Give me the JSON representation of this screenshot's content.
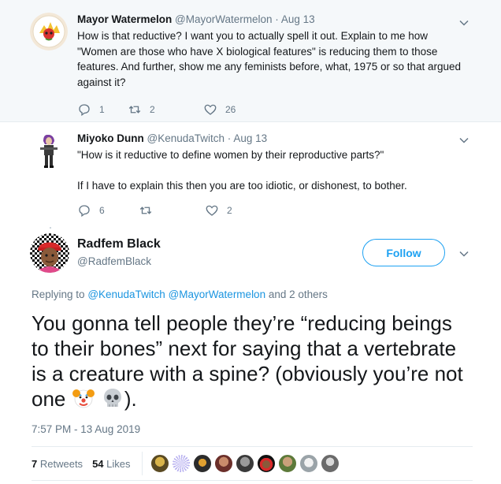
{
  "tweet1": {
    "name": "Mayor Watermelon",
    "handle": "@MayorWatermelon",
    "dot": "·",
    "date": "Aug 13",
    "paragraphs": [
      "How is that reductive? I want you to actually spell it out. Explain to me how \"Women are those who have X biological features\" is reducing them to those features. And further, show me any feminists before, what, 1975 or so that argued against it?"
    ],
    "replies": "1",
    "retweets": "2",
    "likes": "26"
  },
  "tweet2": {
    "name": "Miyoko Dunn",
    "handle": "@KenudaTwitch",
    "dot": "·",
    "date": "Aug 13",
    "paragraphs": [
      "\"How is it reductive to define women by their reproductive parts?\"",
      "If I have to explain this then you are too idiotic, or dishonest, to bother."
    ],
    "replies": "6",
    "retweets": "",
    "likes": "2"
  },
  "main": {
    "name": "Radfem Black",
    "handle": "@RadfemBlack",
    "follow_label": "Follow",
    "replying_prefix": "Replying to",
    "replying_user1": "@KenudaTwitch",
    "replying_user2": "@MayorWatermelon",
    "replying_suffix": "and 2 others",
    "text": "You gonna tell people they’re “reducing beings to their bones” next for saying that a vertebrate is a creature with a spine? (obviously you’re not one",
    "text_end": ").",
    "emojis": [
      "clown-face-emoji",
      "skull-emoji"
    ],
    "timestamp": "7:57 PM - 13 Aug 2019",
    "retweets_count": "7",
    "retweets_label": "Retweets",
    "likes_count": "54",
    "likes_label": "Likes"
  },
  "colors": {
    "accent": "#1da1f2",
    "link": "#1b95e0",
    "muted": "#657786",
    "thread_bg": "#f5f8fa"
  }
}
